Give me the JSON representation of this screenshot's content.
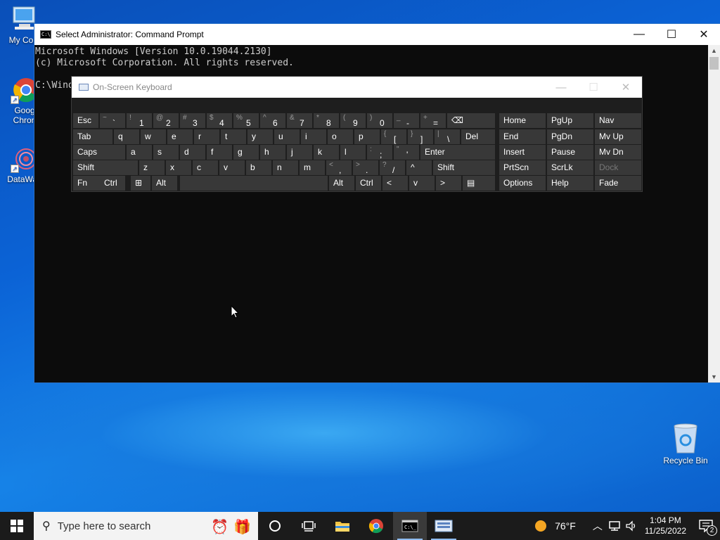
{
  "desktop": {
    "icons": [
      {
        "label": "My Com"
      },
      {
        "label": "Goog\nChron"
      },
      {
        "label": "DataWag"
      }
    ],
    "recycle_bin": {
      "label": "Recycle Bin"
    }
  },
  "cmd": {
    "title": "Select Administrator: Command Prompt",
    "lines": [
      "Microsoft Windows [Version 10.0.19044.2130]",
      "(c) Microsoft Corporation. All rights reserved.",
      "",
      "C:\\Wind"
    ]
  },
  "osk": {
    "title": "On-Screen Keyboard",
    "rows": [
      [
        {
          "main": "Esc"
        },
        {
          "shift": "~",
          "base": "`"
        },
        {
          "shift": "!",
          "base": "1"
        },
        {
          "shift": "@",
          "base": "2"
        },
        {
          "shift": "#",
          "base": "3"
        },
        {
          "shift": "$",
          "base": "4"
        },
        {
          "shift": "%",
          "base": "5"
        },
        {
          "shift": "^",
          "base": "6"
        },
        {
          "shift": "&",
          "base": "7"
        },
        {
          "shift": "*",
          "base": "8"
        },
        {
          "shift": "(",
          "base": "9"
        },
        {
          "shift": ")",
          "base": "0"
        },
        {
          "shift": "_",
          "base": "-"
        },
        {
          "shift": "+",
          "base": "="
        },
        {
          "main": "⌫"
        },
        {
          "main": "Home"
        },
        {
          "main": "PgUp"
        },
        {
          "main": "Nav"
        }
      ],
      [
        {
          "main": "Tab"
        },
        {
          "main": "q"
        },
        {
          "main": "w"
        },
        {
          "main": "e"
        },
        {
          "main": "r"
        },
        {
          "main": "t"
        },
        {
          "main": "y"
        },
        {
          "main": "u"
        },
        {
          "main": "i"
        },
        {
          "main": "o"
        },
        {
          "main": "p"
        },
        {
          "shift": "{",
          "base": "["
        },
        {
          "shift": "}",
          "base": "]"
        },
        {
          "shift": "|",
          "base": "\\"
        },
        {
          "main": "Del"
        },
        {
          "main": "End"
        },
        {
          "main": "PgDn"
        },
        {
          "main": "Mv Up"
        }
      ],
      [
        {
          "main": "Caps"
        },
        {
          "main": "a"
        },
        {
          "main": "s"
        },
        {
          "main": "d"
        },
        {
          "main": "f"
        },
        {
          "main": "g"
        },
        {
          "main": "h"
        },
        {
          "main": "j"
        },
        {
          "main": "k"
        },
        {
          "main": "l"
        },
        {
          "shift": ":",
          "base": ";"
        },
        {
          "shift": "\"",
          "base": "'"
        },
        {
          "main": "Enter"
        },
        {
          "main": "Insert"
        },
        {
          "main": "Pause"
        },
        {
          "main": "Mv Dn"
        }
      ],
      [
        {
          "main": "Shift"
        },
        {
          "main": "z"
        },
        {
          "main": "x"
        },
        {
          "main": "c"
        },
        {
          "main": "v"
        },
        {
          "main": "b"
        },
        {
          "main": "n"
        },
        {
          "main": "m"
        },
        {
          "shift": "<",
          "base": ","
        },
        {
          "shift": ">",
          "base": "."
        },
        {
          "shift": "?",
          "base": "/"
        },
        {
          "main": "^"
        },
        {
          "main": "Shift"
        },
        {
          "main": "PrtScn"
        },
        {
          "main": "ScrLk"
        },
        {
          "main": "Dock"
        }
      ],
      [
        {
          "main": "Fn"
        },
        {
          "main": "Ctrl"
        },
        {
          "main": "⊞"
        },
        {
          "main": "Alt"
        },
        {
          "main": ""
        },
        {
          "main": "Alt"
        },
        {
          "main": "Ctrl"
        },
        {
          "main": "<"
        },
        {
          "main": "v"
        },
        {
          "main": ">"
        },
        {
          "main": "▤"
        },
        {
          "main": "Options"
        },
        {
          "main": "Help"
        },
        {
          "main": "Fade"
        }
      ]
    ]
  },
  "taskbar": {
    "search_placeholder": "Type here to search",
    "weather": "76°F",
    "time": "1:04 PM",
    "date": "11/25/2022",
    "notification_count": "2"
  }
}
